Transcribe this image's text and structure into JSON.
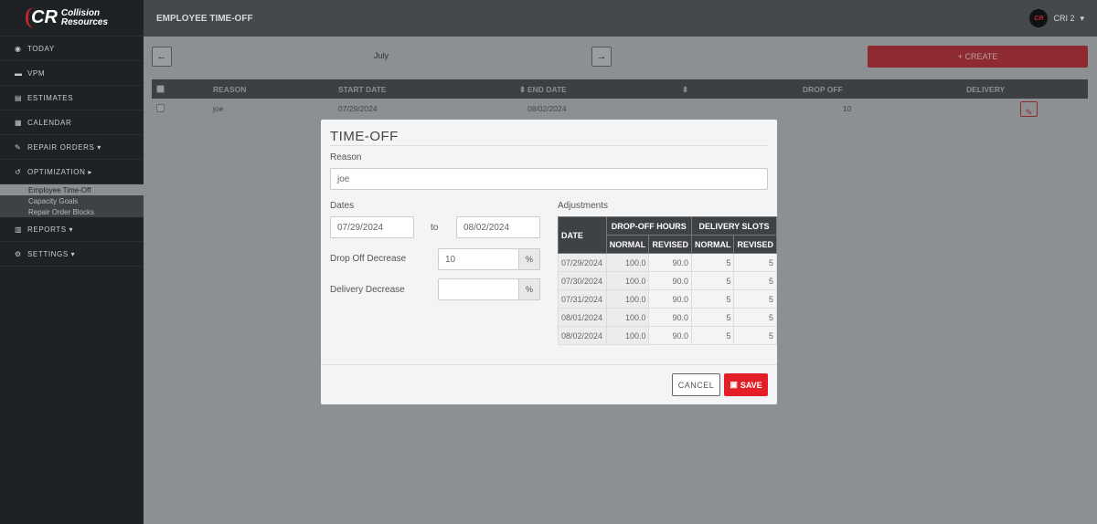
{
  "brand": {
    "logo_mark": "CR",
    "name_line1": "Collision",
    "name_line2": "Resources"
  },
  "sidebar": {
    "items": [
      {
        "label": "TODAY",
        "icon": "dashboard-icon",
        "glyph": "◉"
      },
      {
        "label": "VPM",
        "icon": "car-icon",
        "glyph": "▬"
      },
      {
        "label": "ESTIMATES",
        "icon": "id-card-icon",
        "glyph": "▤"
      },
      {
        "label": "CALENDAR",
        "icon": "calendar-icon",
        "glyph": "▦"
      },
      {
        "label": "REPAIR ORDERS ▾",
        "icon": "wrench-icon",
        "glyph": "✎"
      },
      {
        "label": "OPTIMIZATION ▸",
        "icon": "history-icon",
        "glyph": "↺"
      }
    ],
    "sub_items": [
      "Employee Time-Off",
      "Capacity Goals",
      "Repair Order Blocks"
    ],
    "items_after": [
      {
        "label": "REPORTS ▾",
        "icon": "bar-chart-icon",
        "glyph": "▥"
      },
      {
        "label": "SETTINGS ▾",
        "icon": "gear-icon",
        "glyph": "⚙"
      }
    ]
  },
  "header": {
    "title": "EMPLOYEE TIME-OFF",
    "user": "CRI 2",
    "user_caret": "▾"
  },
  "toolbar": {
    "month": "July",
    "prev": "←",
    "next": "→",
    "create": "+ CREATE"
  },
  "table": {
    "headers": [
      "REASON",
      "START DATE",
      "END DATE",
      "DROP OFF",
      "DELIVERY"
    ],
    "rows": [
      {
        "reason": "joe",
        "start": "07/29/2024",
        "end": "08/02/2024",
        "drop_off": "10",
        "delivery": ""
      }
    ]
  },
  "modal": {
    "title": "TIME-OFF",
    "reason_label": "Reason",
    "reason_value": "joe",
    "dates_label": "Dates",
    "start": "07/29/2024",
    "to": "to",
    "end": "08/02/2024",
    "drop_label": "Drop Off Decrease",
    "drop_value": "10",
    "delivery_label": "Delivery Decrease",
    "delivery_value": "",
    "pct": "%",
    "adjustments_label": "Adjustments",
    "adj_headers": {
      "date": "DATE",
      "drop": "DROP-OFF HOURS",
      "delivery": "DELIVERY SLOTS",
      "normal": "NORMAL",
      "revised": "REVISED"
    },
    "adj_rows": [
      [
        "07/29/2024",
        "100.0",
        "90.0",
        "5",
        "5"
      ],
      [
        "07/30/2024",
        "100.0",
        "90.0",
        "5",
        "5"
      ],
      [
        "07/31/2024",
        "100.0",
        "90.0",
        "5",
        "5"
      ],
      [
        "08/01/2024",
        "100.0",
        "90.0",
        "5",
        "5"
      ],
      [
        "08/02/2024",
        "100.0",
        "90.0",
        "5",
        "5"
      ]
    ],
    "cancel": "CANCEL",
    "save": "SAVE"
  },
  "colors": {
    "accent": "#e31e26",
    "create": "#8e2a31",
    "sidebar": "#1f2225",
    "header": "#45484b"
  }
}
